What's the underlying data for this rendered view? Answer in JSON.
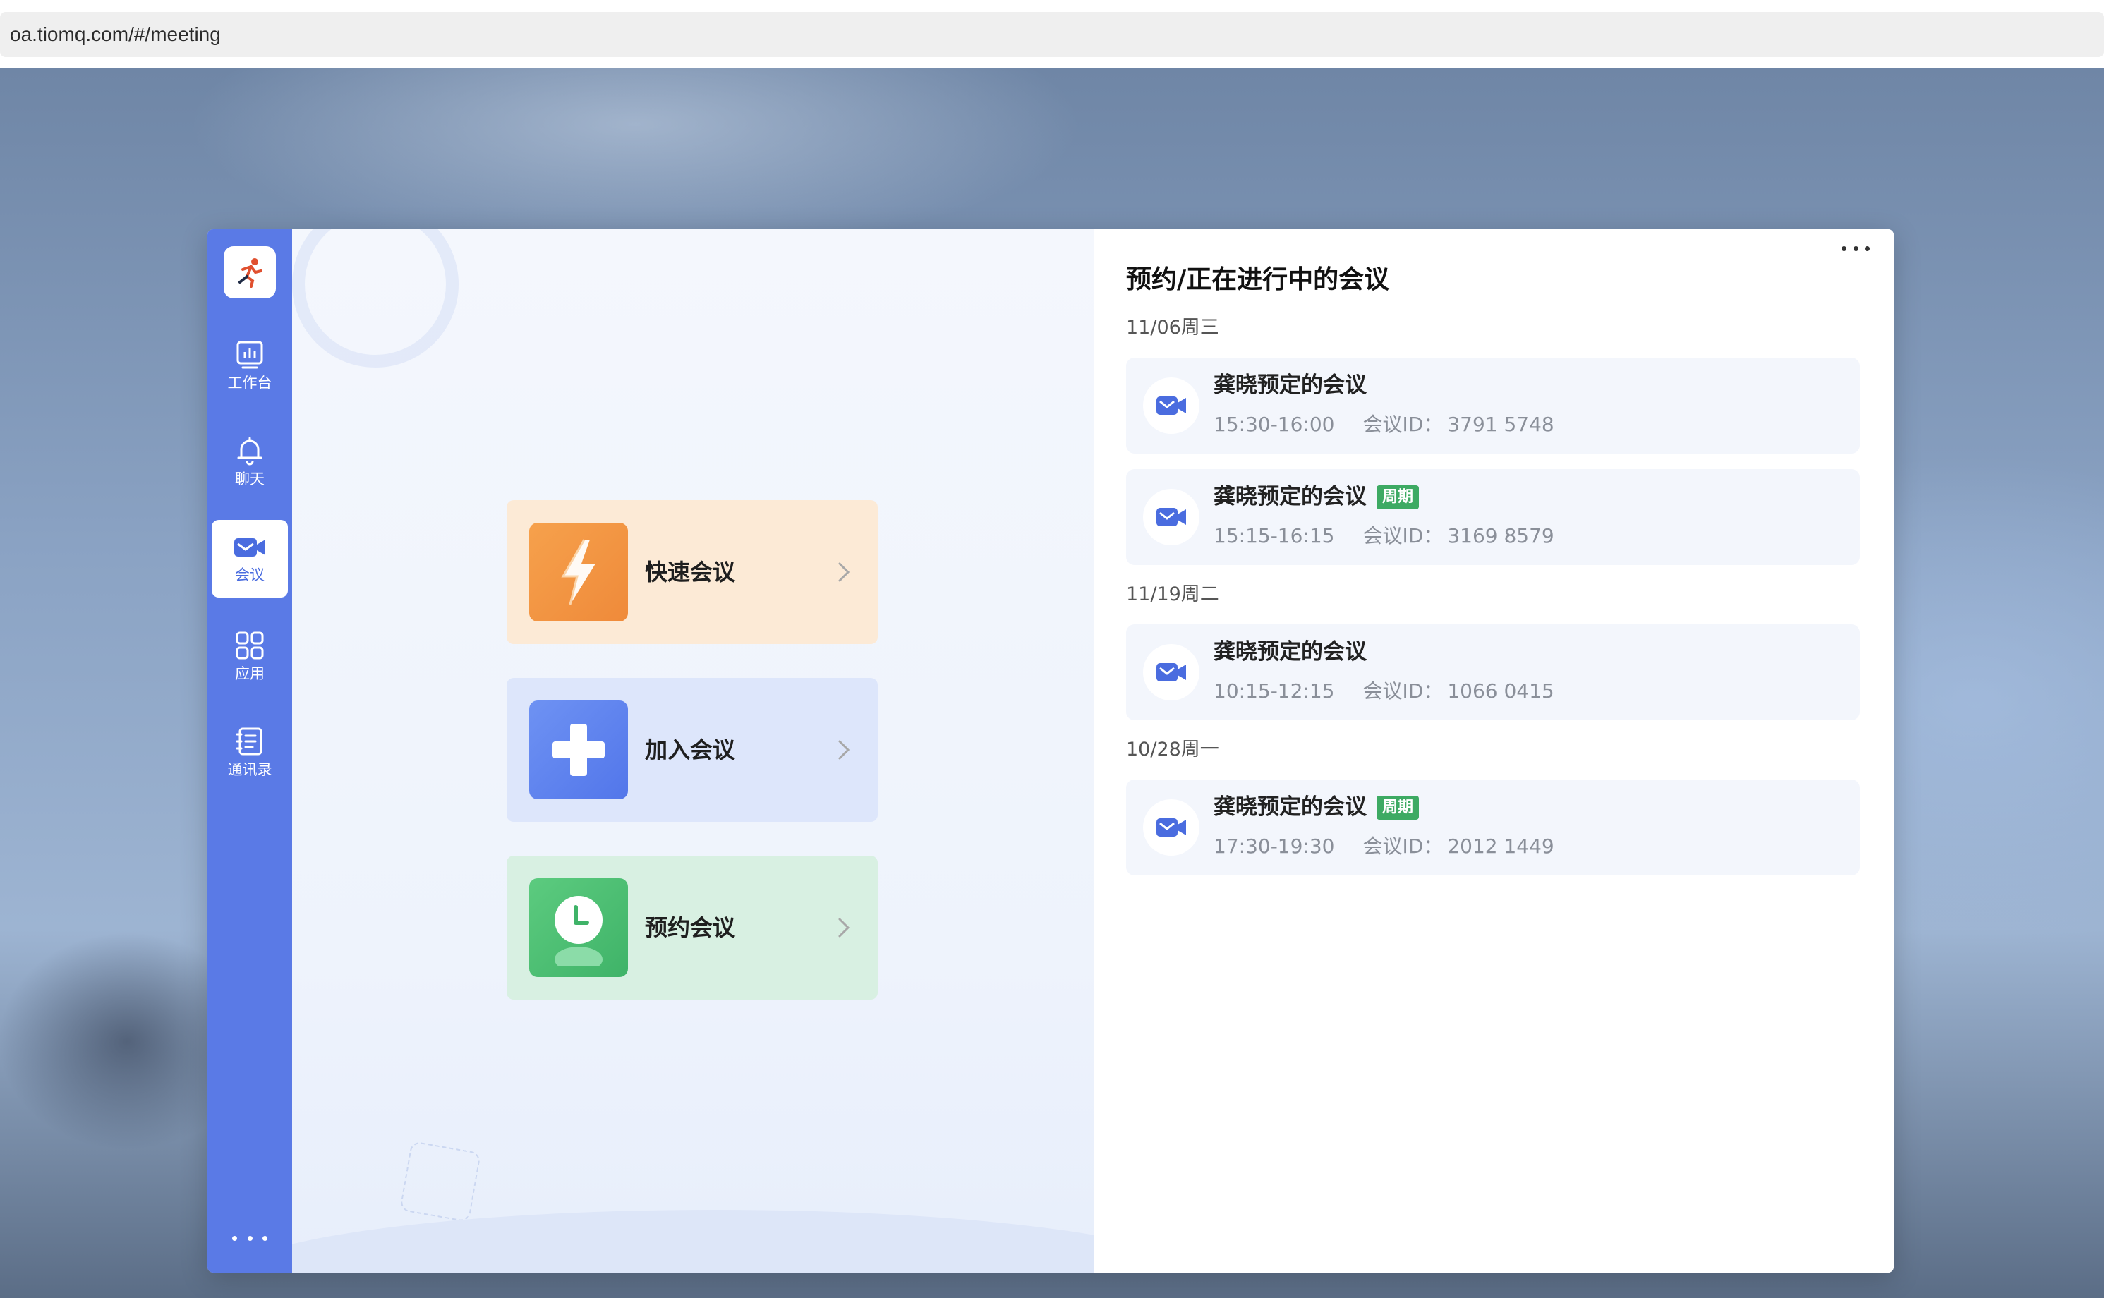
{
  "browser": {
    "url": "oa.tiomq.com/#/meeting"
  },
  "sidebar": {
    "items": [
      {
        "label": "工作台",
        "icon": "dashboard-icon"
      },
      {
        "label": "聊天",
        "icon": "bell-icon"
      },
      {
        "label": "会议",
        "icon": "meeting-icon",
        "active": true
      },
      {
        "label": "应用",
        "icon": "apps-grid-icon"
      },
      {
        "label": "通讯录",
        "icon": "contacts-icon"
      }
    ],
    "more_icon": "more-dots-icon"
  },
  "actions": [
    {
      "label": "快速会议",
      "icon": "lightning-icon"
    },
    {
      "label": "加入会议",
      "icon": "plus-icon"
    },
    {
      "label": "预约会议",
      "icon": "clock-icon"
    }
  ],
  "meetings_panel": {
    "title": "预约/正在进行中的会议",
    "menu_icon": "more-horizontal-icon",
    "id_label": "会议ID：",
    "groups": [
      {
        "date": "11/06周三",
        "meetings": [
          {
            "title": "龚晓预定的会议",
            "time": "15:30-16:00",
            "id": "3791 5748",
            "tag": ""
          },
          {
            "title": "龚晓预定的会议",
            "time": "15:15-16:15",
            "id": "3169 8579",
            "tag": "周期"
          }
        ]
      },
      {
        "date": "11/19周二",
        "meetings": [
          {
            "title": "龚晓预定的会议",
            "time": "10:15-12:15",
            "id": "1066 0415",
            "tag": ""
          }
        ]
      },
      {
        "date": "10/28周一",
        "meetings": [
          {
            "title": "龚晓预定的会议",
            "time": "17:30-19:30",
            "id": "2012 1449",
            "tag": "周期"
          }
        ]
      }
    ]
  },
  "colors": {
    "sidebar": "#5a7ae6",
    "tag_green": "#3daa63",
    "quick_card": "#fcead6",
    "join_card": "#dde6fb",
    "book_card": "#d8f0e2"
  }
}
